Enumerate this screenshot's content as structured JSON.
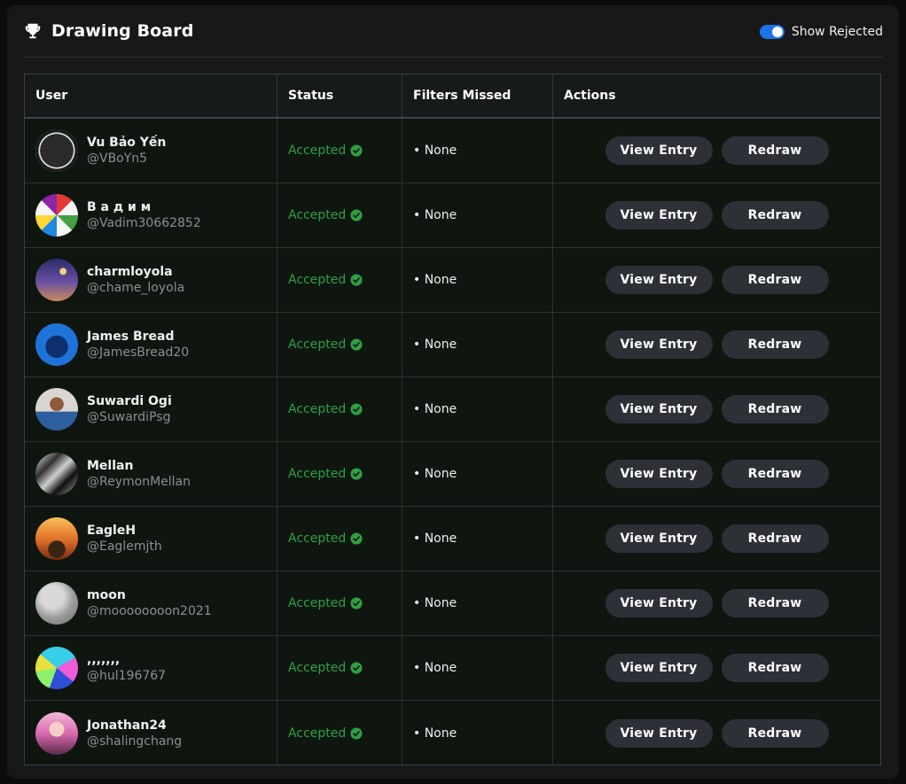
{
  "header": {
    "title": "Drawing Board",
    "toggle_label": "Show Rejected",
    "toggle_on": true
  },
  "columns": [
    "User",
    "Status",
    "Filters Missed",
    "Actions"
  ],
  "actions": {
    "view": "View Entry",
    "redraw": "Redraw"
  },
  "colors": {
    "accepted": "#2ea043",
    "toggle": "#1a73e8",
    "button": "#2e3038"
  },
  "rows": [
    {
      "name": "Vu Bảo Yến",
      "handle": "@VBoYn5",
      "status": "Accepted",
      "filters": "• None",
      "avatar": "brand-logo-avatar"
    },
    {
      "name": "В а д и м",
      "handle": "@Vadim30662852",
      "status": "Accepted",
      "filters": "• None",
      "avatar": "app-icons-avatar"
    },
    {
      "name": "charmloyola",
      "handle": "@chame_loyola",
      "status": "Accepted",
      "filters": "• None",
      "avatar": "night-sky-avatar"
    },
    {
      "name": "James Bread",
      "handle": "@JamesBread20",
      "status": "Accepted",
      "filters": "• None",
      "avatar": "blue-creature-avatar"
    },
    {
      "name": "Suwardi Ogi",
      "handle": "@SuwardiPsg",
      "status": "Accepted",
      "filters": "• None",
      "avatar": "person-photo-avatar"
    },
    {
      "name": "Mellan",
      "handle": "@ReymonMellan",
      "status": "Accepted",
      "filters": "• None",
      "avatar": "monochrome-art-avatar"
    },
    {
      "name": "EagleH",
      "handle": "@Eaglemjth",
      "status": "Accepted",
      "filters": "• None",
      "avatar": "eagle-sunset-avatar"
    },
    {
      "name": "moon",
      "handle": "@moooooooon2021",
      "status": "Accepted",
      "filters": "• None",
      "avatar": "moon-avatar"
    },
    {
      "name": ",,,,,,,",
      "handle": "@hul196767",
      "status": "Accepted",
      "filters": "• None",
      "avatar": "colorful-art-avatar"
    },
    {
      "name": "Jonathan24",
      "handle": "@shalingchang",
      "status": "Accepted",
      "filters": "• None",
      "avatar": "anime-girl-avatar"
    }
  ]
}
